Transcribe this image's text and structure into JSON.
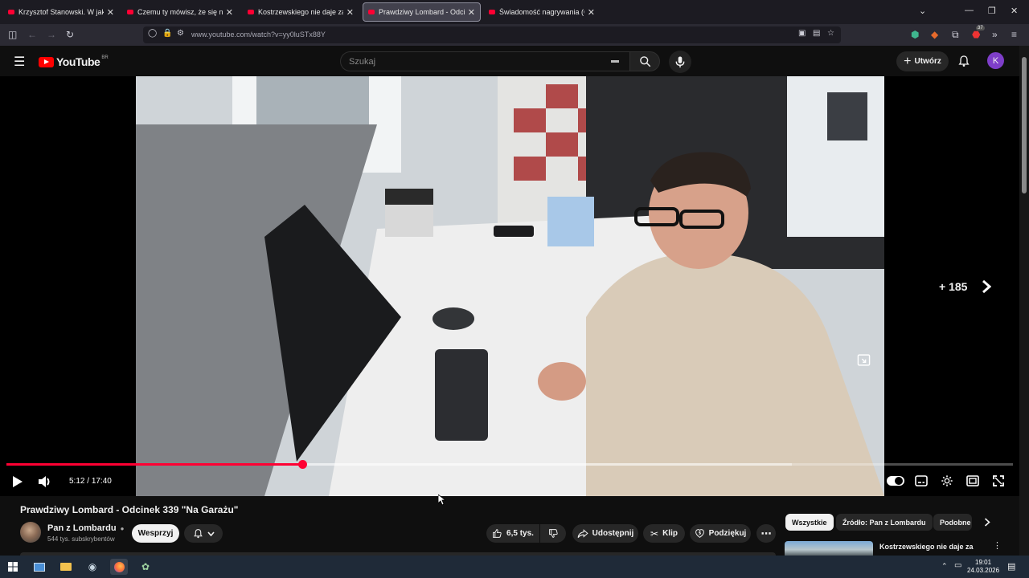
{
  "browser": {
    "tabs": [
      {
        "title": "Krzysztof Stanowski. W jakiej sp",
        "active": false
      },
      {
        "title": "Czemu ty mówisz, że się na cieł",
        "active": false
      },
      {
        "title": "Kostrzewskiego nie daje za wyg",
        "active": false
      },
      {
        "title": "Prawdziwy Lombard - Odcinek",
        "active": true
      },
      {
        "title": "Świadomość nagrywania (Giełd",
        "active": false
      }
    ],
    "url": "www.youtube.com/watch?v=yy0luSTx88Y",
    "extension_badge": "37"
  },
  "youtube": {
    "logo_text": "YouTube",
    "country_code": "BR",
    "search_placeholder": "Szukaj",
    "create_label": "Utwórz",
    "avatar_letter": "K"
  },
  "player": {
    "overlay_count": "+ 185",
    "time_current": "5:12",
    "time_total": "17:40",
    "progress": 0.2943,
    "buffered": 0.78
  },
  "video": {
    "title": "Prawdziwy Lombard - Odcinek 339 \"Na Garażu\"",
    "channel": "Pan z Lombardu",
    "subscribers": "544 tys. subskrybentów",
    "support_label": "Wesprzyj",
    "likes": "6,5 tys.",
    "share_label": "Udostępnij",
    "clip_label": "Klip",
    "thanks_label": "Podziękuj"
  },
  "sidebar": {
    "chips": [
      "Wszystkie",
      "Źródło: Pan z Lombardu",
      "Podobne"
    ],
    "recommended_title": "Kostrzewskiego nie daje za wygraną"
  },
  "taskbar": {
    "time": "19:01",
    "date": "24.03.2026"
  }
}
